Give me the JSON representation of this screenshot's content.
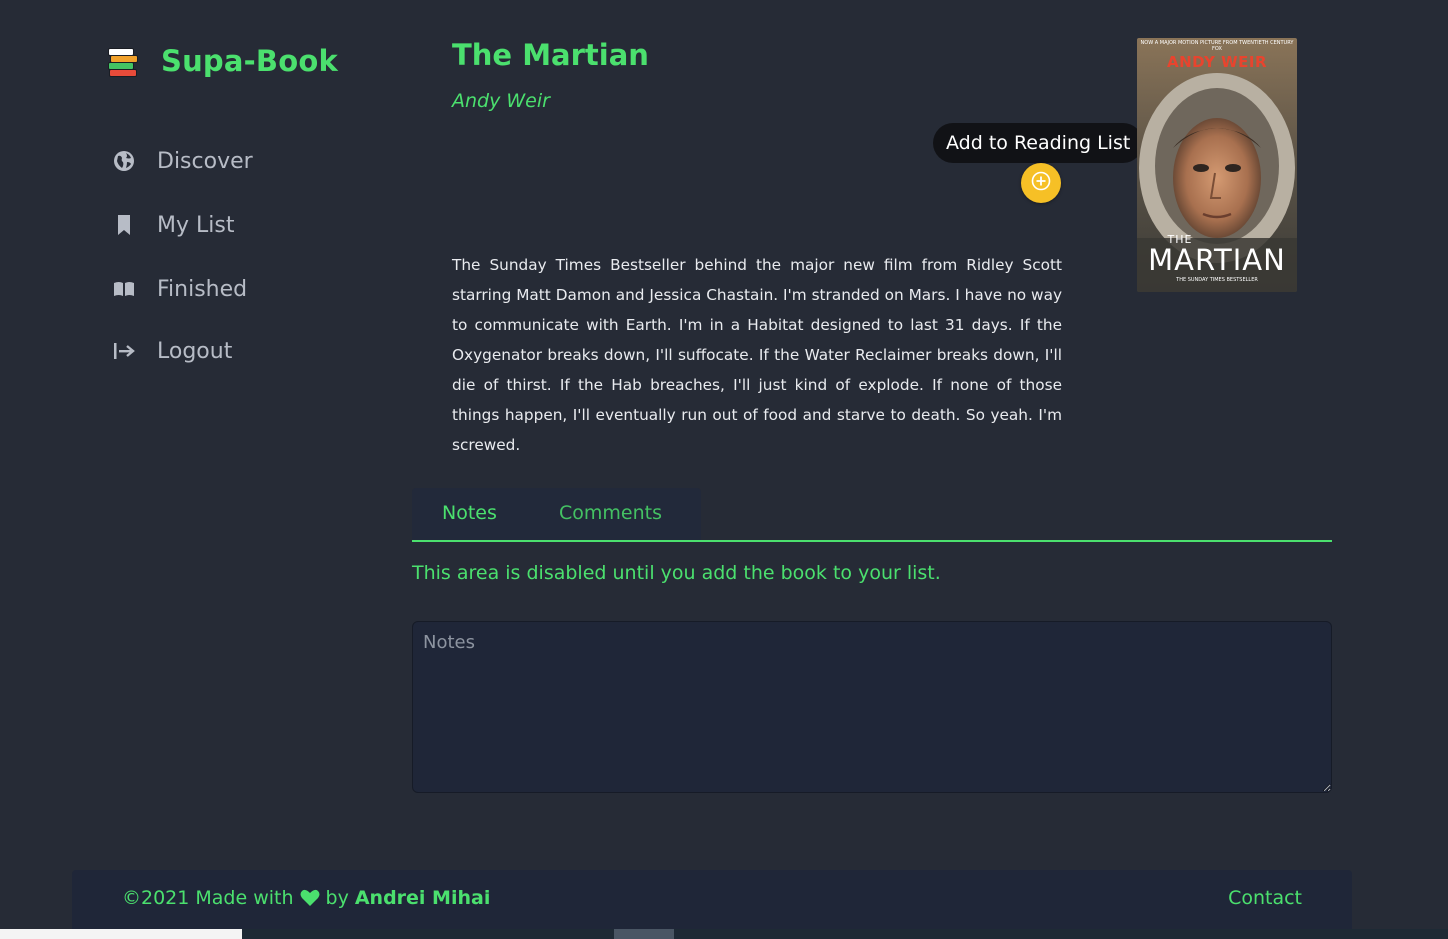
{
  "brand": {
    "title": "Supa-Book",
    "logo_icon": "books-stack-icon"
  },
  "sidebar": {
    "items": [
      {
        "label": "Discover",
        "icon": "globe-icon"
      },
      {
        "label": "My List",
        "icon": "bookmark-icon"
      },
      {
        "label": "Finished",
        "icon": "open-book-icon"
      },
      {
        "label": "Logout",
        "icon": "logout-icon"
      }
    ]
  },
  "book": {
    "title": "The Martian",
    "author": "Andy Weir",
    "description": "The Sunday Times Bestseller behind the major new film from Ridley Scott starring Matt Damon and Jessica Chastain. I'm stranded on Mars. I have no way to communicate with Earth. I'm in a Habitat designed to last 31 days. If the Oxygenator breaks down, I'll suffocate. If the Water Reclaimer breaks down, I'll die of thirst. If the Hab breaches, I'll just kind of explode. If none of those things happen, I'll eventually run out of food and starve to death. So yeah. I'm screwed.",
    "cover": {
      "top_text": "NOW A MAJOR MOTION PICTURE FROM TWENTIETH CENTURY FOX",
      "author": "ANDY WEIR",
      "the": "THE",
      "title": "MARTIAN",
      "bottom_text": "THE SUNDAY TIMES BESTSELLER"
    }
  },
  "actions": {
    "add_tooltip": "Add to Reading List",
    "add_icon": "plus-icon"
  },
  "tabs": {
    "notes": "Notes",
    "comments": "Comments"
  },
  "notes": {
    "disabled_message": "This area is disabled until you add the book to your list.",
    "placeholder": "Notes"
  },
  "footer": {
    "copyright": "©2021 Made with",
    "by": "by",
    "author": "Andrei Mihai",
    "contact": "Contact"
  },
  "colors": {
    "accent": "#4be06e",
    "background": "#262b36",
    "panel": "#1f2638",
    "add_button": "#f6c026"
  }
}
